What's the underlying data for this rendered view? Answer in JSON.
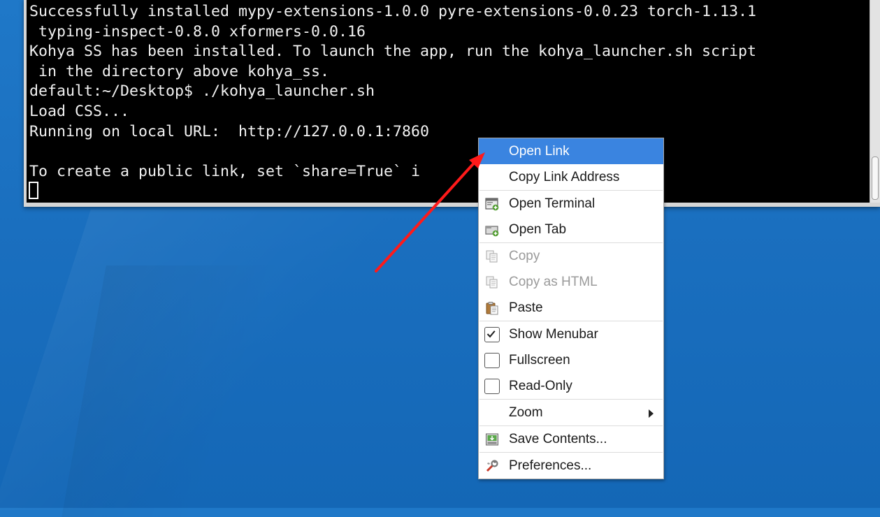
{
  "terminal": {
    "lines": [
      "Successfully installed mypy-extensions-1.0.0 pyre-extensions-0.0.23 torch-1.13.1",
      " typing-inspect-0.8.0 xformers-0.0.16",
      "Kohya SS has been installed. To launch the app, run the kohya_launcher.sh script",
      " in the directory above kohya_ss.",
      "default:~/Desktop$ ./kohya_launcher.sh",
      "Load CSS...",
      "Running on local URL:  http://127.0.0.1:7860",
      "",
      "To create a public link, set `share=True` i"
    ],
    "background": "#000000",
    "foreground": "#f2f2f2"
  },
  "context_menu": {
    "items": [
      {
        "label": "Open Link",
        "state": "highlighted"
      },
      {
        "label": "Copy Link Address"
      },
      {
        "label": "Open Terminal",
        "icon": "open-terminal-icon"
      },
      {
        "label": "Open Tab",
        "icon": "open-tab-icon"
      },
      {
        "label": "Copy",
        "icon": "copy-icon",
        "state": "disabled"
      },
      {
        "label": "Copy as HTML",
        "icon": "copy-html-icon",
        "state": "disabled"
      },
      {
        "label": "Paste",
        "icon": "paste-icon"
      },
      {
        "label": "Show Menubar",
        "checked": true
      },
      {
        "label": "Fullscreen",
        "checked": false
      },
      {
        "label": "Read-Only",
        "checked": false
      },
      {
        "label": "Zoom",
        "submenu": true
      },
      {
        "label": "Save Contents...",
        "icon": "save-contents-icon"
      },
      {
        "label": "Preferences...",
        "icon": "preferences-icon"
      }
    ],
    "highlight_color": "#3a84e0"
  },
  "annotation": {
    "arrow_color": "#ff1a1a"
  },
  "desktop": {
    "background": "#1a6fbf"
  }
}
